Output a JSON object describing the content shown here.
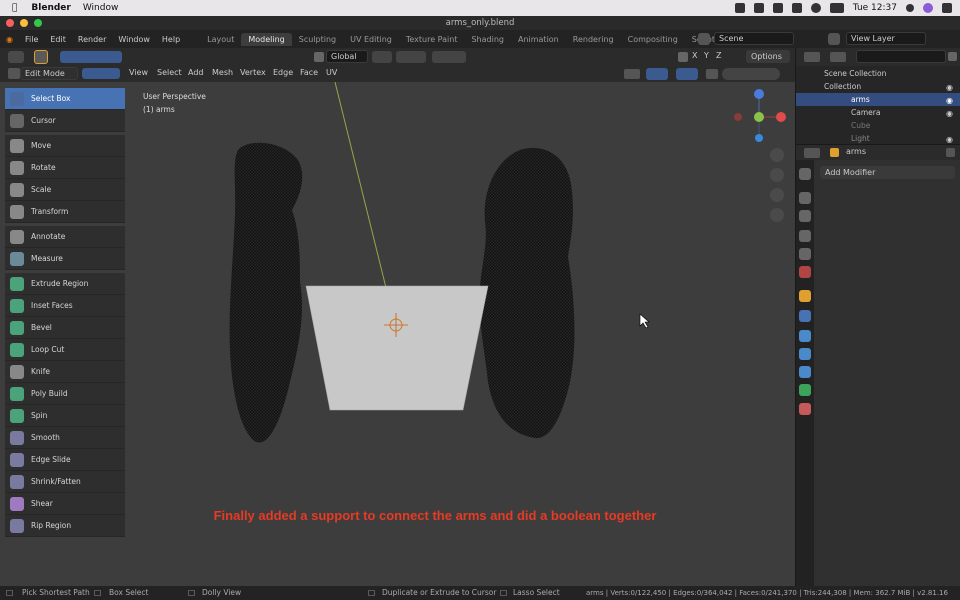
{
  "mac_menu": {
    "app": "Blender",
    "window": "Window",
    "time": "Tue 12:37"
  },
  "title": "arms_only.blend",
  "main_menu": [
    "File",
    "Edit",
    "Render",
    "Window",
    "Help"
  ],
  "workspace_tabs": [
    "Layout",
    "Modeling",
    "Sculpting",
    "UV Editing",
    "Texture Paint",
    "Shading",
    "Animation",
    "Rendering",
    "Compositing",
    "Scripting"
  ],
  "active_tab": "Modeling",
  "scene": "Scene",
  "view_layer": "View Layer",
  "transform_orientation": "Global",
  "options_label": "Options",
  "axes": [
    "X",
    "Y",
    "Z"
  ],
  "mode": "Edit Mode",
  "header_menu": [
    "View",
    "Select",
    "Add",
    "Mesh",
    "Vertex",
    "Edge",
    "Face",
    "UV"
  ],
  "viewport": {
    "perspective": "User Perspective",
    "object": "(1) arms"
  },
  "tools": [
    {
      "label": "Select Box",
      "icon": "select-box-icon",
      "selected": true
    },
    {
      "label": "Cursor",
      "icon": "cursor-icon"
    },
    {
      "label": "Move",
      "icon": "move-icon"
    },
    {
      "label": "Rotate",
      "icon": "rotate-icon"
    },
    {
      "label": "Scale",
      "icon": "scale-icon"
    },
    {
      "label": "Transform",
      "icon": "transform-icon"
    },
    {
      "label": "Annotate",
      "icon": "annotate-icon"
    },
    {
      "label": "Measure",
      "icon": "measure-icon"
    },
    {
      "label": "Extrude Region",
      "icon": "extrude-icon"
    },
    {
      "label": "Inset Faces",
      "icon": "inset-icon"
    },
    {
      "label": "Bevel",
      "icon": "bevel-icon"
    },
    {
      "label": "Loop Cut",
      "icon": "loop-cut-icon"
    },
    {
      "label": "Knife",
      "icon": "knife-icon"
    },
    {
      "label": "Poly Build",
      "icon": "poly-build-icon"
    },
    {
      "label": "Spin",
      "icon": "spin-icon"
    },
    {
      "label": "Smooth",
      "icon": "smooth-icon"
    },
    {
      "label": "Edge Slide",
      "icon": "edge-slide-icon"
    },
    {
      "label": "Shrink/Fatten",
      "icon": "shrink-fatten-icon"
    },
    {
      "label": "Shear",
      "icon": "shear-icon"
    },
    {
      "label": "Rip Region",
      "icon": "rip-icon"
    }
  ],
  "caption": "Finally added a support to connect the arms and did a boolean together",
  "outliner": {
    "scene_collection": "Scene Collection",
    "items": [
      {
        "label": "Collection"
      },
      {
        "label": "arms"
      },
      {
        "label": "Camera"
      },
      {
        "label": "Cube"
      },
      {
        "label": "Light"
      }
    ]
  },
  "properties": {
    "object": "arms",
    "add_modifier": "Add Modifier"
  },
  "status": {
    "pick": "Pick Shortest Path",
    "box": "Box Select",
    "dolly": "Dolly View",
    "dup": "Duplicate or Extrude to Cursor",
    "lasso": "Lasso Select",
    "stats": "arms | Verts:0/122,450 | Edges:0/364,042 | Faces:0/241,370 | Tris:244,308 | Mem: 362.7 MiB | v2.81.16"
  },
  "colors": {
    "accent": "#4772b3",
    "caption": "#e83a24",
    "support": "#c8c8c8"
  }
}
